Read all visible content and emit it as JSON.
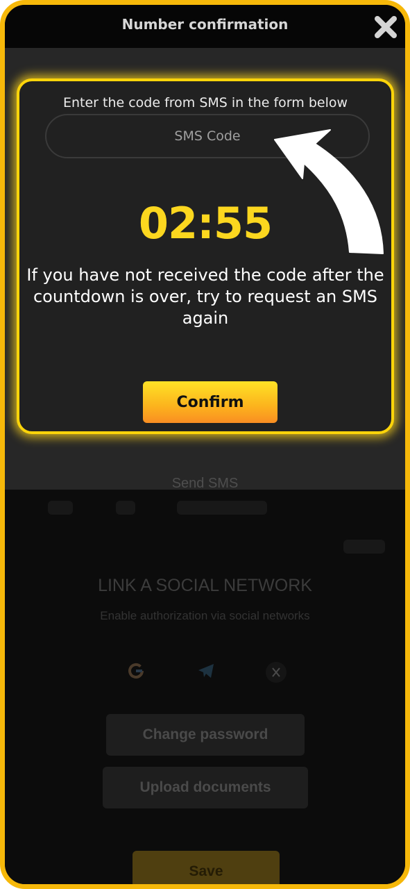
{
  "header": {
    "title": "Number confirmation",
    "close_icon": "close-icon"
  },
  "popup": {
    "instruction": "Enter the code from SMS in the form below",
    "sms_input": {
      "placeholder": "SMS Code",
      "value": ""
    },
    "timer": "02:55",
    "notice": "If you have not received the code after the countdown is over, try to request an SMS again",
    "confirm_label": "Confirm"
  },
  "modal": {
    "send_sms_label": "Send SMS"
  },
  "background": {
    "social_title": "LINK A SOCIAL NETWORK",
    "social_subtitle": "Enable authorization via social networks",
    "social_icons": [
      "google-icon",
      "telegram-icon",
      "x-icon"
    ],
    "change_password_label": "Change password",
    "upload_documents_label": "Upload documents",
    "save_label": "Save"
  },
  "colors": {
    "accent": "#fcd40a",
    "frame": "#f6b80a",
    "timer": "#fcd71f"
  }
}
